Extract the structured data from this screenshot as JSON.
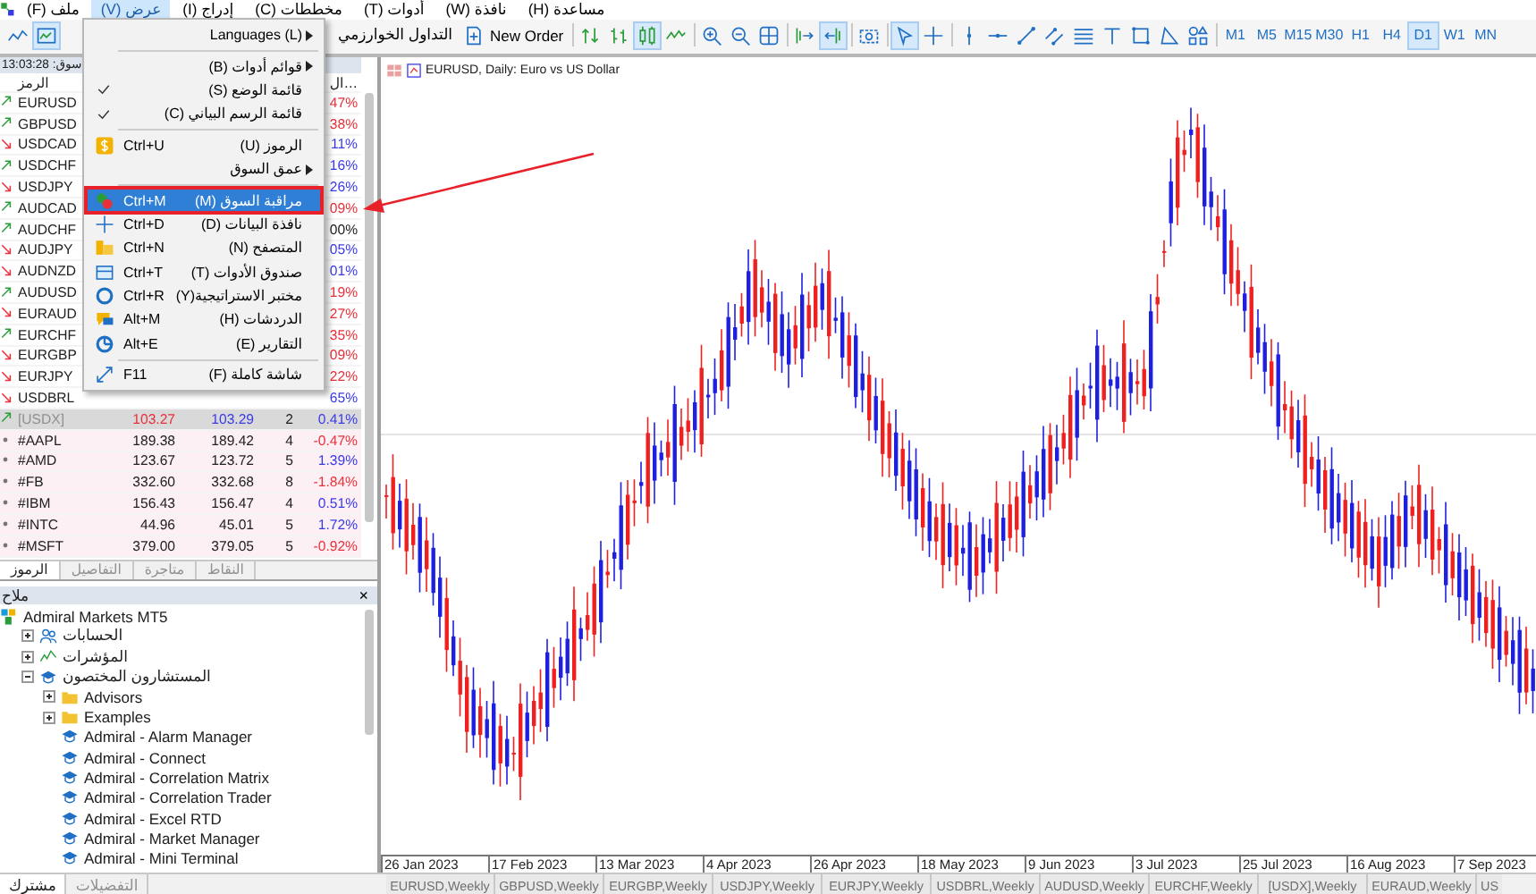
{
  "menu_bar": [
    {
      "label": "مساعدة (H)",
      "selected": false
    },
    {
      "label": "نافذة (W)",
      "selected": false
    },
    {
      "label": "أدوات (T)",
      "selected": false
    },
    {
      "label": "مخططات (C)",
      "selected": false
    },
    {
      "label": "إدراج (I)",
      "selected": false
    },
    {
      "label": "عرض (V)",
      "selected": true
    },
    {
      "label": "ملف (F)",
      "selected": false
    }
  ],
  "toolbar": {
    "left_tools": [
      {
        "kind": "line-chart",
        "selected": false
      },
      {
        "kind": "template",
        "selected": true
      }
    ],
    "algo_trading": "التداول الخوارزمي",
    "new_order": "New Order",
    "tool_groups": [
      [
        {
          "kind": "buy-sell",
          "selected": false
        },
        {
          "kind": "bar-chart",
          "selected": false
        },
        {
          "kind": "candles",
          "selected": true
        },
        {
          "kind": "line",
          "selected": false
        }
      ],
      [
        {
          "kind": "zoom-in",
          "selected": false
        },
        {
          "kind": "zoom-out",
          "selected": false
        },
        {
          "kind": "grid",
          "selected": false
        }
      ],
      [
        {
          "kind": "auto-scroll",
          "selected": false
        },
        {
          "kind": "chart-shift",
          "selected": true
        }
      ],
      [
        {
          "kind": "screenshot",
          "selected": false
        }
      ],
      [
        {
          "kind": "cursor",
          "selected": true
        },
        {
          "kind": "crosshair",
          "selected": false
        }
      ],
      [
        {
          "kind": "vertical-line",
          "selected": false
        },
        {
          "kind": "horizontal-line",
          "selected": false
        },
        {
          "kind": "trend-line",
          "selected": false
        },
        {
          "kind": "channel",
          "selected": false
        },
        {
          "kind": "fibonacci",
          "selected": false
        },
        {
          "kind": "text",
          "selected": false
        },
        {
          "kind": "rectangle",
          "selected": false
        },
        {
          "kind": "triangle",
          "selected": false
        },
        {
          "kind": "shapes",
          "selected": false
        }
      ]
    ],
    "timeframes": [
      {
        "label": "M1",
        "selected": false
      },
      {
        "label": "M5",
        "selected": false
      },
      {
        "label": "M15",
        "selected": false
      },
      {
        "label": "M30",
        "selected": false
      },
      {
        "label": "H1",
        "selected": false
      },
      {
        "label": "H4",
        "selected": false
      },
      {
        "label": "D1",
        "selected": true
      },
      {
        "label": "W1",
        "selected": false
      },
      {
        "label": "MN",
        "selected": false
      }
    ]
  },
  "view_menu": {
    "items": [
      {
        "kind": "submenu",
        "label": "Languages (L)",
        "selected": false
      },
      {
        "kind": "separator"
      },
      {
        "kind": "submenu",
        "label": "قوائم أدوات (B)",
        "selected": false
      },
      {
        "kind": "check",
        "label": "قائمة الوضع (S)",
        "checked": true,
        "selected": false
      },
      {
        "kind": "check",
        "label": "قائمة الرسم البياني (C)",
        "checked": true,
        "selected": false
      },
      {
        "kind": "separator"
      },
      {
        "kind": "symbols",
        "label": "الرموز (U)",
        "shortcut": "Ctrl+U",
        "selected": false
      },
      {
        "kind": "submenu",
        "label": "عمق السوق",
        "selected": false
      },
      {
        "kind": "separator"
      },
      {
        "kind": "market-watch",
        "label": "مراقبة السوق (M)",
        "shortcut": "Ctrl+M",
        "selected": true
      },
      {
        "kind": "data-window",
        "label": "نافذة البيانات (D)",
        "shortcut": "Ctrl+D",
        "selected": false
      },
      {
        "kind": "navigator",
        "label": "المتصفح (N)",
        "shortcut": "Ctrl+N",
        "selected": false
      },
      {
        "kind": "toolbox",
        "label": "صندوق الأدوات (T)",
        "shortcut": "Ctrl+T",
        "selected": false
      },
      {
        "kind": "tester",
        "label": "مختبر الاستراتيجية(Y)",
        "shortcut": "Ctrl+R",
        "selected": false
      },
      {
        "kind": "chat",
        "label": "الدردشات (H)",
        "shortcut": "Alt+M",
        "selected": false
      },
      {
        "kind": "reports",
        "label": "التقارير (E)",
        "shortcut": "Alt+E",
        "selected": false
      },
      {
        "kind": "separator"
      },
      {
        "kind": "fullscreen",
        "label": "شاشة كاملة (F)",
        "shortcut": "F11",
        "selected": false
      }
    ]
  },
  "market_watch": {
    "header": "سوق: 13:03:28",
    "columns": [
      "ال…",
      "الرمز"
    ],
    "rows": [
      {
        "kind": "forex",
        "symbol": "EURUSD",
        "rising": true,
        "change": "47%",
        "color": "#e8303a"
      },
      {
        "kind": "forex",
        "symbol": "GBPUSD",
        "rising": true,
        "change": "38%",
        "color": "#e8303a"
      },
      {
        "kind": "forex",
        "symbol": "USDCAD",
        "rising": false,
        "change": "11%",
        "color": "#3a3ae8"
      },
      {
        "kind": "forex",
        "symbol": "USDCHF",
        "rising": true,
        "change": "16%",
        "color": "#3a3ae8"
      },
      {
        "kind": "forex",
        "symbol": "USDJPY",
        "rising": false,
        "change": "26%",
        "color": "#3a3ae8"
      },
      {
        "kind": "forex",
        "symbol": "AUDCAD",
        "rising": true,
        "change": "09%",
        "color": "#e8303a"
      },
      {
        "kind": "forex",
        "symbol": "AUDCHF",
        "rising": true,
        "change": "00%",
        "color": "#202020"
      },
      {
        "kind": "forex",
        "symbol": "AUDJPY",
        "rising": false,
        "change": "05%",
        "color": "#3a3ae8"
      },
      {
        "kind": "forex",
        "symbol": "AUDNZD",
        "rising": false,
        "change": "01%",
        "color": "#3a3ae8"
      },
      {
        "kind": "forex",
        "symbol": "AUDUSD",
        "rising": true,
        "change": "19%",
        "color": "#e8303a"
      },
      {
        "kind": "forex",
        "symbol": "EURAUD",
        "rising": false,
        "change": "27%",
        "color": "#e8303a"
      },
      {
        "kind": "forex",
        "symbol": "EURCHF",
        "rising": true,
        "change": "35%",
        "color": "#e8303a"
      },
      {
        "kind": "forex",
        "symbol": "EURGBP",
        "rising": false,
        "change": "09%",
        "color": "#e8303a"
      },
      {
        "kind": "forex",
        "symbol": "EURJPY",
        "rising": false,
        "change": "22%",
        "color": "#e8303a"
      },
      {
        "kind": "forex",
        "symbol": "USDBRL",
        "rising": false,
        "change": "65%",
        "color": "#3a3ae8"
      },
      {
        "kind": "index",
        "symbol": "[USDX]",
        "rising": true,
        "bid": "103.27",
        "ask": "103.29",
        "spread": "2",
        "change": "0.41%",
        "color": "#3a3ae8"
      },
      {
        "kind": "stock",
        "symbol": "#AAPL",
        "bid": "189.38",
        "ask": "189.42",
        "spread": "4",
        "change": "-0.47%",
        "color": "#e8303a"
      },
      {
        "kind": "stock",
        "symbol": "#AMD",
        "bid": "123.67",
        "ask": "123.72",
        "spread": "5",
        "change": "1.39%",
        "color": "#3a3ae8"
      },
      {
        "kind": "stock",
        "symbol": "#FB",
        "bid": "332.60",
        "ask": "332.68",
        "spread": "8",
        "change": "-1.84%",
        "color": "#e8303a"
      },
      {
        "kind": "stock",
        "symbol": "#IBM",
        "bid": "156.43",
        "ask": "156.47",
        "spread": "4",
        "change": "0.51%",
        "color": "#3a3ae8"
      },
      {
        "kind": "stock",
        "symbol": "#INTC",
        "bid": "44.96",
        "ask": "45.01",
        "spread": "5",
        "change": "1.72%",
        "color": "#3a3ae8"
      },
      {
        "kind": "stock",
        "symbol": "#MSFT",
        "bid": "379.00",
        "ask": "379.05",
        "spread": "5",
        "change": "-0.92%",
        "color": "#e8303a"
      }
    ],
    "tabs": [
      {
        "label": "النقاط",
        "selected": false
      },
      {
        "label": "متاجرة",
        "selected": false
      },
      {
        "label": "التفاصيل",
        "selected": false
      },
      {
        "label": "الرموز",
        "selected": true
      }
    ]
  },
  "navigator": {
    "title": "ملاح",
    "close": "×",
    "tree": [
      {
        "kind": "root",
        "label": "Admiral Markets MT5",
        "children": [
          {
            "kind": "accounts",
            "label": "الحسابات",
            "expanded": false
          },
          {
            "kind": "indicators",
            "label": "المؤشرات",
            "expanded": false
          },
          {
            "kind": "experts",
            "label": "المستشارون المختصون",
            "expanded": true,
            "children": [
              {
                "kind": "folder",
                "label": "Advisors",
                "expanded": false
              },
              {
                "kind": "folder",
                "label": "Examples",
                "expanded": false
              },
              {
                "kind": "expert",
                "label": "Admiral - Alarm Manager"
              },
              {
                "kind": "expert",
                "label": "Admiral - Connect"
              },
              {
                "kind": "expert",
                "label": "Admiral - Correlation Matrix"
              },
              {
                "kind": "expert",
                "label": "Admiral - Correlation Trader"
              },
              {
                "kind": "expert",
                "label": "Admiral - Excel RTD"
              },
              {
                "kind": "expert",
                "label": "Admiral - Market Manager"
              },
              {
                "kind": "expert",
                "label": "Admiral - Mini Terminal"
              }
            ]
          }
        ]
      }
    ],
    "tabs": [
      {
        "label": "التفضيلات",
        "selected": false
      },
      {
        "label": "مشترك",
        "selected": true
      }
    ]
  },
  "chart": {
    "title": "EURUSD, Daily:  Euro vs US Dollar",
    "x_labels": [
      "26 Jan 2023",
      "17 Feb 2023",
      "13 Mar 2023",
      "4 Apr 2023",
      "26 Apr 2023",
      "18 May 2023",
      "9 Jun 2023",
      "3 Jul 2023",
      "25 Jul 2023",
      "16 Aug 2023",
      "7 Sep 2023"
    ]
  },
  "chart_tabs": [
    {
      "label": "EURUSD,Weekly",
      "selected": false
    },
    {
      "label": "GBPUSD,Weekly",
      "selected": false
    },
    {
      "label": "EURGBP,Weekly",
      "selected": false
    },
    {
      "label": "USDJPY,Weekly",
      "selected": false
    },
    {
      "label": "EURJPY,Weekly",
      "selected": false
    },
    {
      "label": "USDBRL,Weekly",
      "selected": false
    },
    {
      "label": "AUDUSD,Weekly",
      "selected": false
    },
    {
      "label": "EURCHF,Weekly",
      "selected": false
    },
    {
      "label": "[USDX],Weekly",
      "selected": false
    },
    {
      "label": "EURAUD,Weekly",
      "selected": false
    },
    {
      "label": "US",
      "selected": false
    }
  ]
}
